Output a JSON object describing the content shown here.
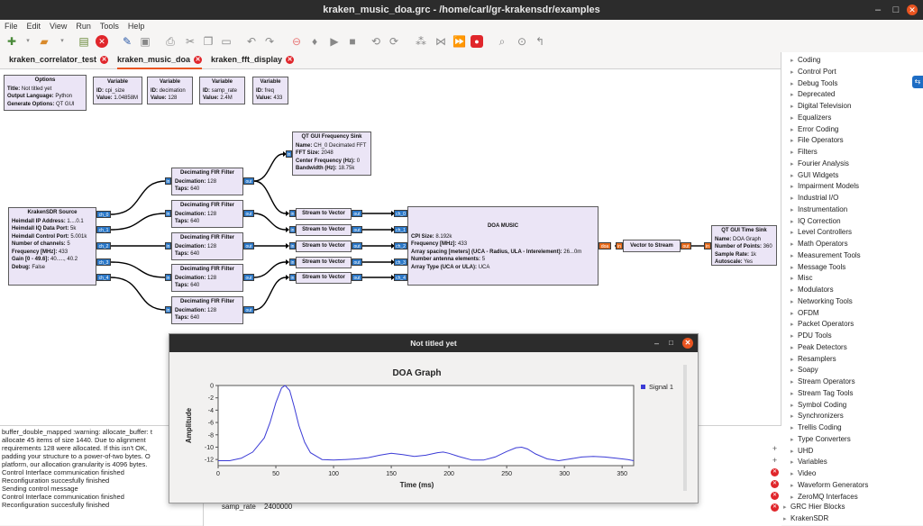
{
  "window": {
    "title": "kraken_music_doa.grc - /home/carl/gr-krakensdr/examples"
  },
  "menu": [
    "File",
    "Edit",
    "View",
    "Run",
    "Tools",
    "Help"
  ],
  "tabs": [
    {
      "label": "kraken_correlator_test",
      "active": false
    },
    {
      "label": "kraken_music_doa",
      "active": true
    },
    {
      "label": "kraken_fft_display",
      "active": false
    }
  ],
  "blocks": {
    "options": {
      "title": "Options",
      "rows": [
        [
          "Title:",
          "Not titled yet"
        ],
        [
          "Output Language:",
          "Python"
        ],
        [
          "Generate Options:",
          "QT GUI"
        ]
      ]
    },
    "var1": {
      "title": "Variable",
      "rows": [
        [
          "ID:",
          "cpi_size"
        ],
        [
          "Value:",
          "1.04858M"
        ]
      ]
    },
    "var2": {
      "title": "Variable",
      "rows": [
        [
          "ID:",
          "decimation"
        ],
        [
          "Value:",
          "128"
        ]
      ]
    },
    "var3": {
      "title": "Variable",
      "rows": [
        [
          "ID:",
          "samp_rate"
        ],
        [
          "Value:",
          "2.4M"
        ]
      ]
    },
    "var4": {
      "title": "Variable",
      "rows": [
        [
          "ID:",
          "freq"
        ],
        [
          "Value:",
          "433"
        ]
      ]
    },
    "kraken": {
      "title": "KrakenSDR Source",
      "rows": [
        [
          "Heimdall IP Address:",
          "1....0.1"
        ],
        [
          "Heimdall IQ Data Port:",
          "5k"
        ],
        [
          "Heimdall Control Port:",
          "5.001k"
        ],
        [
          "Number of channels:",
          "5"
        ],
        [
          "Frequency [MHz]:",
          "433"
        ],
        [
          "Gain [0 - 49.6]:",
          "40....., 40.2"
        ],
        [
          "Debug:",
          "False"
        ]
      ]
    },
    "fir": {
      "title": "Decimating FIR Filter",
      "rows": [
        [
          "Decimation:",
          "128"
        ],
        [
          "Taps:",
          "640"
        ]
      ]
    },
    "freqsink": {
      "title": "QT GUI Frequency Sink",
      "rows": [
        [
          "Name:",
          "CH_0 Decimated FFT"
        ],
        [
          "FFT Size:",
          "2048"
        ],
        [
          "Center Frequency (Hz):",
          "0"
        ],
        [
          "Bandwidth (Hz):",
          "18.75k"
        ]
      ]
    },
    "s2v": {
      "title": "Stream to Vector"
    },
    "music": {
      "title": "DOA MUSIC",
      "rows": [
        [
          "CPI Size:",
          "8.192k"
        ],
        [
          "Frequency [MHz]:",
          "433"
        ],
        [
          "Array spacing [meters] (UCA - Radius,  ULA - Interelement):",
          "26...0m"
        ],
        [
          "Number antenna elements:",
          "5"
        ],
        [
          "Array Type (UCA or ULA):",
          "UCA"
        ]
      ]
    },
    "v2s": {
      "title": "Vector to Stream"
    },
    "timesink": {
      "title": "QT GUI Time Sink",
      "rows": [
        [
          "Name:",
          "DOA Graph"
        ],
        [
          "Number of Points:",
          "360"
        ],
        [
          "Sample Rate:",
          "1k"
        ],
        [
          "Autoscale:",
          "Yes"
        ]
      ]
    }
  },
  "ports": {
    "ch": [
      "ch_0",
      "ch_1",
      "ch_2",
      "ch_3",
      "ch_4"
    ],
    "in": "in",
    "out": "out",
    "doa": "doa"
  },
  "sidebar": {
    "items": [
      "Coding",
      "Control Port",
      "Debug Tools",
      "Deprecated",
      "Digital Television",
      "Equalizers",
      "Error Coding",
      "File Operators",
      "Filters",
      "Fourier Analysis",
      "GUI Widgets",
      "Impairment Models",
      "Industrial I/O",
      "Instrumentation",
      "IQ Correction",
      "Level Controllers",
      "Math Operators",
      "Measurement Tools",
      "Message Tools",
      "Misc",
      "Modulators",
      "Networking Tools",
      "OFDM",
      "Packet Operators",
      "PDU Tools",
      "Peak Detectors",
      "Resamplers",
      "Soapy",
      "Stream Operators",
      "Stream Tag Tools",
      "Symbol Coding",
      "Synchronizers",
      "Trellis Coding",
      "Type Converters",
      "UHD",
      "Variables",
      "Video",
      "Waveform Generators",
      "ZeroMQ Interfaces"
    ],
    "top_items": [
      "GRC Hier Blocks",
      "KrakenSDR"
    ]
  },
  "console": {
    "lines": [
      "buffer_double_mapped :warning: allocate_buffer: t",
      "allocate  45 items of size 1440. Due to alignment",
      "requirements  128 were allocated.  If this isn't OK,",
      "padding  your structure to a power-of-two bytes.  O",
      "platform, our allocation granularity is 4096 bytes.",
      "Control Interface communication finished",
      "Reconfiguration succesfully finished",
      "Sending control message",
      "Control Interface communication finished",
      "Reconfiguration succesfully finished"
    ]
  },
  "variables_panel": {
    "name": "samp_rate",
    "value": "2400000"
  },
  "qt_window": {
    "title": "Not titled yet"
  },
  "colors": {
    "accent": "#e95420",
    "block_bg": "#ebe5f6",
    "port_complex": "#2b78c8",
    "port_float": "#e66a1a",
    "series": "#3b3bd6"
  },
  "chart_data": {
    "type": "line",
    "title": "DOA Graph",
    "xlabel": "Time (ms)",
    "ylabel": "Amplitude",
    "xlim": [
      0,
      360
    ],
    "ylim": [
      -13,
      0
    ],
    "xticks": [
      0,
      50,
      100,
      150,
      200,
      250,
      300,
      350
    ],
    "yticks": [
      0,
      -2,
      -4,
      -6,
      -8,
      -10,
      -12
    ],
    "legend": "top-right",
    "series": [
      {
        "name": "Signal 1",
        "x": [
          0,
          10,
          20,
          30,
          40,
          45,
          50,
          55,
          58,
          62,
          66,
          70,
          75,
          80,
          90,
          100,
          110,
          120,
          130,
          140,
          150,
          160,
          170,
          180,
          190,
          195,
          200,
          210,
          220,
          230,
          240,
          250,
          258,
          263,
          268,
          275,
          285,
          295,
          305,
          315,
          325,
          335,
          345,
          355,
          360
        ],
        "y": [
          -12.2,
          -12.2,
          -11.8,
          -10.8,
          -8.5,
          -6.0,
          -2.8,
          -0.4,
          0.0,
          -0.8,
          -3.5,
          -6.5,
          -9.2,
          -10.9,
          -12.0,
          -12.1,
          -12.0,
          -11.9,
          -11.7,
          -11.3,
          -11.0,
          -11.2,
          -11.5,
          -11.3,
          -10.9,
          -10.8,
          -11.0,
          -11.6,
          -12.1,
          -12.1,
          -11.6,
          -10.7,
          -10.1,
          -10.0,
          -10.3,
          -11.1,
          -11.9,
          -12.2,
          -11.9,
          -11.6,
          -11.5,
          -11.6,
          -11.8,
          -12.0,
          -12.2
        ]
      }
    ]
  }
}
